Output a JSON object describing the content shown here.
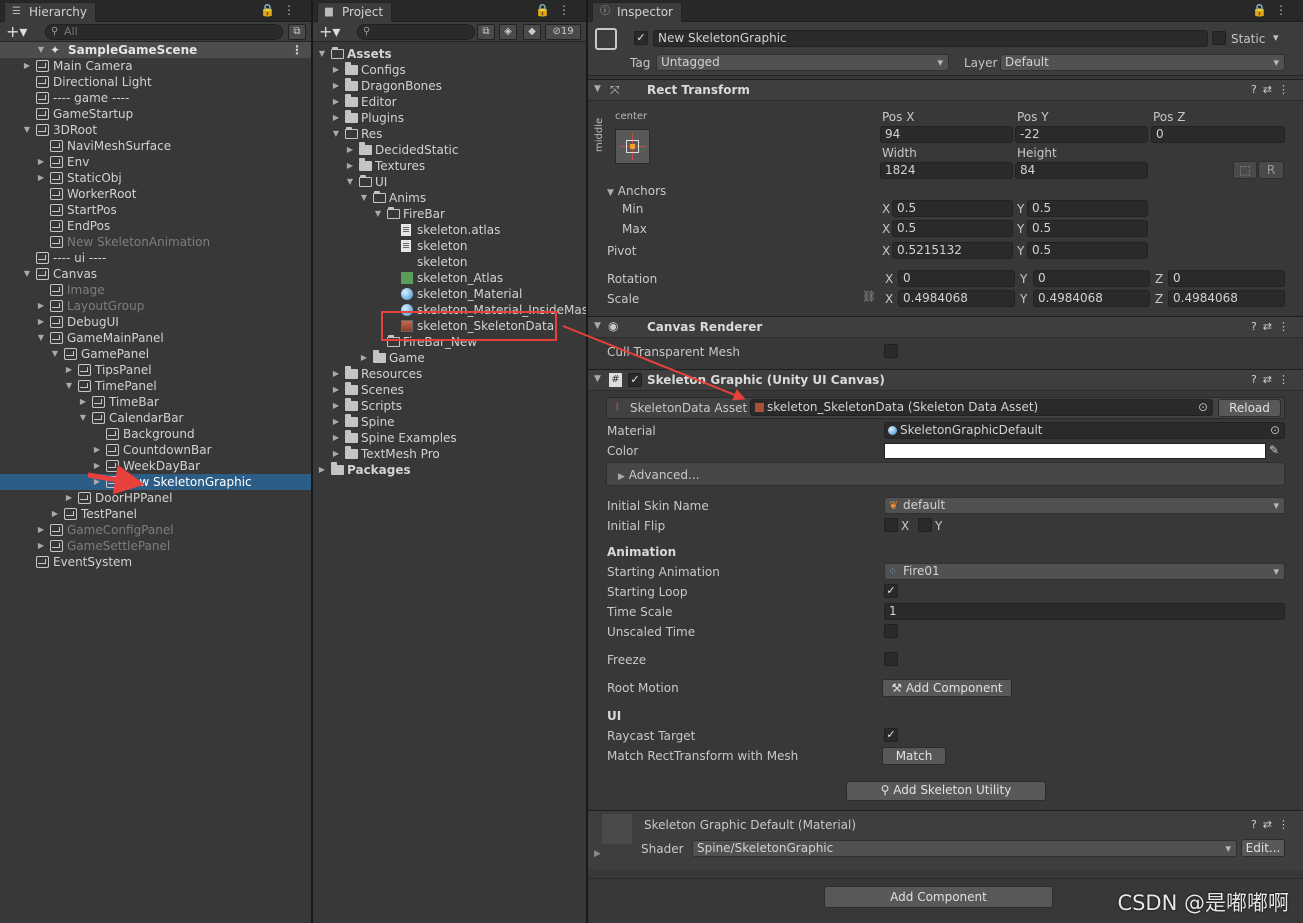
{
  "hierarchy": {
    "tab": "Hierarchy",
    "search_placeholder": "All",
    "scene": "SampleGameScene",
    "items": [
      "Main Camera",
      "Directional Light",
      "---- game ----",
      "GameStartup",
      "3DRoot",
      "NaviMeshSurface",
      "Env",
      "StaticObj",
      "WorkerRoot",
      "StartPos",
      "EndPos",
      "New SkeletonAnimation",
      "---- ui ----",
      "Canvas",
      "Image",
      "LayoutGroup",
      "DebugUI",
      "GameMainPanel",
      "GamePanel",
      "TipsPanel",
      "TimePanel",
      "TimeBar",
      "CalendarBar",
      "Background",
      "CountdownBar",
      "WeekDayBar",
      "New SkeletonGraphic",
      "DoorHPPanel",
      "TestPanel",
      "GameConfigPanel",
      "GameSettlePanel",
      "EventSystem"
    ]
  },
  "project": {
    "tab": "Project",
    "hidden_count": "19",
    "items": [
      "Assets",
      "Configs",
      "DragonBones",
      "Editor",
      "Plugins",
      "Res",
      "DecidedStatic",
      "Textures",
      "UI",
      "Anims",
      "FireBar",
      "skeleton.atlas",
      "skeleton",
      "skeleton",
      "skeleton_Atlas",
      "skeleton_Material",
      "skeleton_Material_InsideMask",
      "skeleton_SkeletonData",
      "FireBar_New",
      "Game",
      "Resources",
      "Scenes",
      "Scripts",
      "Spine",
      "Spine Examples",
      "TextMesh Pro",
      "Packages"
    ]
  },
  "inspector": {
    "tab": "Inspector",
    "object_name": "New SkeletonGraphic",
    "static_label": "Static",
    "tag_label": "Tag",
    "tag_value": "Untagged",
    "layer_label": "Layer",
    "layer_value": "Default",
    "rect": {
      "title": "Rect Transform",
      "anchor_h": "center",
      "anchor_v": "middle",
      "posx_label": "Pos X",
      "posy_label": "Pos Y",
      "posz_label": "Pos Z",
      "posx": "94",
      "posy": "-22",
      "posz": "0",
      "width_label": "Width",
      "height_label": "Height",
      "width": "1824",
      "height": "84",
      "r_button": "R",
      "anchors": "Anchors",
      "min": "Min",
      "max": "Max",
      "pivot": "Pivot",
      "min_x": "0.5",
      "min_y": "0.5",
      "max_x": "0.5",
      "max_y": "0.5",
      "pivot_x": "0.5215132",
      "pivot_y": "0.5",
      "rotation": "Rotation",
      "scale": "Scale",
      "rot_x": "0",
      "rot_y": "0",
      "rot_z": "0",
      "scale_x": "0.4984068",
      "scale_y": "0.4984068",
      "scale_z": "0.4984068",
      "x": "X",
      "y": "Y",
      "z": "Z"
    },
    "canvas_renderer": {
      "title": "Canvas Renderer",
      "cull": "Cull Transparent Mesh"
    },
    "skeleton_graphic": {
      "title": "Skeleton Graphic (Unity UI Canvas)",
      "data_asset_label": "SkeletonData Asset",
      "data_asset_value": "skeleton_SkeletonData (Skeleton Data Asset)",
      "reload": "Reload",
      "material_label": "Material",
      "material_value": "SkeletonGraphicDefault",
      "color_label": "Color",
      "advanced": "Advanced...",
      "skin_label": "Initial Skin Name",
      "skin_value": "default",
      "flip_label": "Initial Flip",
      "animation_header": "Animation",
      "starting_anim_label": "Starting Animation",
      "starting_anim_value": "Fire01",
      "starting_loop_label": "Starting Loop",
      "time_scale_label": "Time Scale",
      "time_scale_value": "1",
      "unscaled_label": "Unscaled Time",
      "freeze_label": "Freeze",
      "root_motion_label": "Root Motion",
      "add_component_small": "Add Component",
      "ui_header": "UI",
      "raycast_label": "Raycast Target",
      "match_label": "Match RectTransform with Mesh",
      "match_button": "Match",
      "add_utility": "Add Skeleton Utility"
    },
    "material_section": {
      "title": "Skeleton Graphic Default (Material)",
      "shader_label": "Shader",
      "shader_value": "Spine/SkeletonGraphic",
      "edit_button": "Edit..."
    },
    "add_component": "Add Component"
  },
  "watermark": "CSDN @是嘟嘟啊",
  "colors": {
    "selection": "#2c5d87",
    "annotation": "#e8403a"
  }
}
